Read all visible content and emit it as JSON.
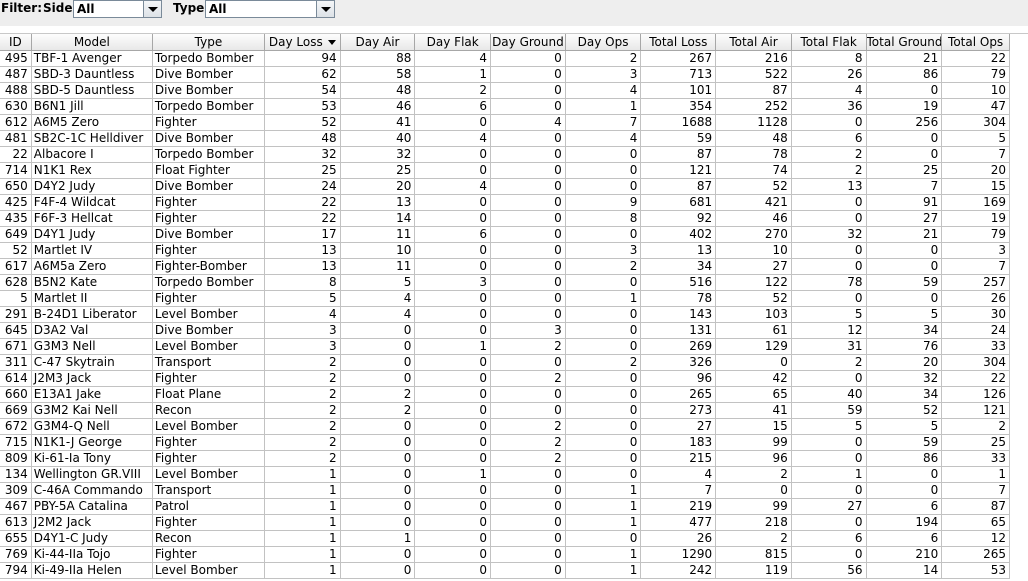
{
  "filter": {
    "label": "Filter:",
    "side_label": "Side:",
    "side_value": "All",
    "type_label": "Type:",
    "type_value": "All"
  },
  "table": {
    "columns": [
      "ID",
      "Model",
      "Type",
      "Day Loss",
      "Day Air",
      "Day Flak",
      "Day Ground",
      "Day Ops",
      "Total Loss",
      "Total Air",
      "Total Flak",
      "Total Ground",
      "Total Ops"
    ],
    "sorted_column": "Day Loss",
    "sort_direction": "descending",
    "rows": [
      [
        "495",
        "TBF-1 Avenger",
        "Torpedo Bomber",
        "94",
        "88",
        "4",
        "0",
        "2",
        "267",
        "216",
        "8",
        "21",
        "22"
      ],
      [
        "487",
        "SBD-3 Dauntless",
        "Dive Bomber",
        "62",
        "58",
        "1",
        "0",
        "3",
        "713",
        "522",
        "26",
        "86",
        "79"
      ],
      [
        "488",
        "SBD-5 Dauntless",
        "Dive Bomber",
        "54",
        "48",
        "2",
        "0",
        "4",
        "101",
        "87",
        "4",
        "0",
        "10"
      ],
      [
        "630",
        "B6N1 Jill",
        "Torpedo Bomber",
        "53",
        "46",
        "6",
        "0",
        "1",
        "354",
        "252",
        "36",
        "19",
        "47"
      ],
      [
        "612",
        "A6M5 Zero",
        "Fighter",
        "52",
        "41",
        "0",
        "4",
        "7",
        "1688",
        "1128",
        "0",
        "256",
        "304"
      ],
      [
        "481",
        "SB2C-1C Helldiver",
        "Dive Bomber",
        "48",
        "40",
        "4",
        "0",
        "4",
        "59",
        "48",
        "6",
        "0",
        "5"
      ],
      [
        "22",
        "Albacore I",
        "Torpedo Bomber",
        "32",
        "32",
        "0",
        "0",
        "0",
        "87",
        "78",
        "2",
        "0",
        "7"
      ],
      [
        "714",
        "N1K1 Rex",
        "Float Fighter",
        "25",
        "25",
        "0",
        "0",
        "0",
        "121",
        "74",
        "2",
        "25",
        "20"
      ],
      [
        "650",
        "D4Y2 Judy",
        "Dive Bomber",
        "24",
        "20",
        "4",
        "0",
        "0",
        "87",
        "52",
        "13",
        "7",
        "15"
      ],
      [
        "425",
        "F4F-4 Wildcat",
        "Fighter",
        "22",
        "13",
        "0",
        "0",
        "9",
        "681",
        "421",
        "0",
        "91",
        "169"
      ],
      [
        "435",
        "F6F-3 Hellcat",
        "Fighter",
        "22",
        "14",
        "0",
        "0",
        "8",
        "92",
        "46",
        "0",
        "27",
        "19"
      ],
      [
        "649",
        "D4Y1 Judy",
        "Dive Bomber",
        "17",
        "11",
        "6",
        "0",
        "0",
        "402",
        "270",
        "32",
        "21",
        "79"
      ],
      [
        "52",
        "Martlet IV",
        "Fighter",
        "13",
        "10",
        "0",
        "0",
        "3",
        "13",
        "10",
        "0",
        "0",
        "3"
      ],
      [
        "617",
        "A6M5a Zero",
        "Fighter-Bomber",
        "13",
        "11",
        "0",
        "0",
        "2",
        "34",
        "27",
        "0",
        "0",
        "7"
      ],
      [
        "628",
        "B5N2 Kate",
        "Torpedo Bomber",
        "8",
        "5",
        "3",
        "0",
        "0",
        "516",
        "122",
        "78",
        "59",
        "257"
      ],
      [
        "5",
        "Martlet II",
        "Fighter",
        "5",
        "4",
        "0",
        "0",
        "1",
        "78",
        "52",
        "0",
        "0",
        "26"
      ],
      [
        "291",
        "B-24D1 Liberator",
        "Level Bomber",
        "4",
        "4",
        "0",
        "0",
        "0",
        "143",
        "103",
        "5",
        "5",
        "30"
      ],
      [
        "645",
        "D3A2 Val",
        "Dive Bomber",
        "3",
        "0",
        "0",
        "3",
        "0",
        "131",
        "61",
        "12",
        "34",
        "24"
      ],
      [
        "671",
        "G3M3 Nell",
        "Level Bomber",
        "3",
        "0",
        "1",
        "2",
        "0",
        "269",
        "129",
        "31",
        "76",
        "33"
      ],
      [
        "311",
        "C-47 Skytrain",
        "Transport",
        "2",
        "0",
        "0",
        "0",
        "2",
        "326",
        "0",
        "2",
        "20",
        "304"
      ],
      [
        "614",
        "J2M3 Jack",
        "Fighter",
        "2",
        "0",
        "0",
        "2",
        "0",
        "96",
        "42",
        "0",
        "32",
        "22"
      ],
      [
        "660",
        "E13A1 Jake",
        "Float Plane",
        "2",
        "2",
        "0",
        "0",
        "0",
        "265",
        "65",
        "40",
        "34",
        "126"
      ],
      [
        "669",
        "G3M2 Kai Nell",
        "Recon",
        "2",
        "2",
        "0",
        "0",
        "0",
        "273",
        "41",
        "59",
        "52",
        "121"
      ],
      [
        "672",
        "G3M4-Q Nell",
        "Level Bomber",
        "2",
        "0",
        "0",
        "2",
        "0",
        "27",
        "15",
        "5",
        "5",
        "2"
      ],
      [
        "715",
        "N1K1-J George",
        "Fighter",
        "2",
        "0",
        "0",
        "2",
        "0",
        "183",
        "99",
        "0",
        "59",
        "25"
      ],
      [
        "809",
        "Ki-61-Ia Tony",
        "Fighter",
        "2",
        "0",
        "0",
        "2",
        "0",
        "215",
        "96",
        "0",
        "86",
        "33"
      ],
      [
        "134",
        "Wellington GR.VIII",
        "Level Bomber",
        "1",
        "0",
        "1",
        "0",
        "0",
        "4",
        "2",
        "1",
        "0",
        "1"
      ],
      [
        "309",
        "C-46A Commando",
        "Transport",
        "1",
        "0",
        "0",
        "0",
        "1",
        "7",
        "0",
        "0",
        "0",
        "7"
      ],
      [
        "467",
        "PBY-5A Catalina",
        "Patrol",
        "1",
        "0",
        "0",
        "0",
        "1",
        "219",
        "99",
        "27",
        "6",
        "87"
      ],
      [
        "613",
        "J2M2 Jack",
        "Fighter",
        "1",
        "0",
        "0",
        "0",
        "1",
        "477",
        "218",
        "0",
        "194",
        "65"
      ],
      [
        "655",
        "D4Y1-C Judy",
        "Recon",
        "1",
        "1",
        "0",
        "0",
        "0",
        "26",
        "2",
        "6",
        "6",
        "12"
      ],
      [
        "769",
        "Ki-44-IIa Tojo",
        "Fighter",
        "1",
        "0",
        "0",
        "0",
        "1",
        "1290",
        "815",
        "0",
        "210",
        "265"
      ],
      [
        "794",
        "Ki-49-IIa Helen",
        "Level Bomber",
        "1",
        "0",
        "0",
        "0",
        "1",
        "242",
        "119",
        "56",
        "14",
        "53"
      ]
    ]
  }
}
